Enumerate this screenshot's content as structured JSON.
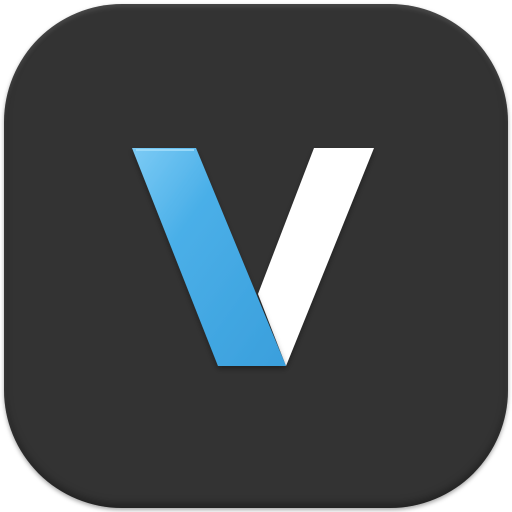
{
  "app_icon": {
    "logo_letter": "V",
    "icon_name": "v-logo-icon",
    "colors": {
      "tile_background": "#333333",
      "stroke_left": "#4AAFE8",
      "stroke_left_highlight": "#7CCBF5",
      "stroke_right": "#FFFFFF"
    }
  }
}
